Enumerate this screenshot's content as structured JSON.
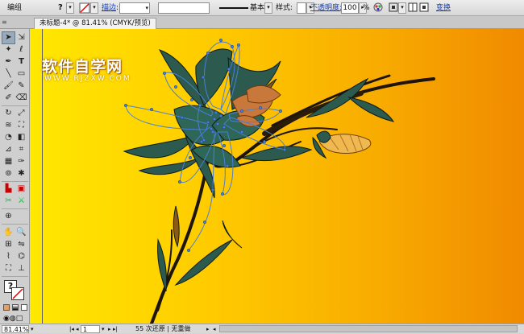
{
  "control_bar": {
    "mode_label": "编组",
    "stroke_label": "描边",
    "stroke_value": "",
    "brush_label": "基本",
    "style_label": "样式:",
    "opacity_label": "不透明度:",
    "opacity_value": "100",
    "percent": "%",
    "transform_label": "变换"
  },
  "document": {
    "tab_title": "未标题-4* @ 81.41% (CMYK/预览)"
  },
  "watermark": {
    "site_name": "软件自学网",
    "url": "WWW.RJZXW.COM"
  },
  "status_bar": {
    "zoom": "81.41%",
    "page": "1",
    "status_text": "55 次还原 | 无重做"
  },
  "colors": {
    "canvas_left": "#ffe800",
    "canvas_right": "#f08a00",
    "leaf_fill": "#2c5a4f",
    "stem": "#1e1408",
    "bud_fill": "#f0b850",
    "selection_path": "#4a7fd8"
  },
  "icons": {
    "selection_tool": "arrow-icon",
    "type_tool": "T-icon",
    "rectangle_tool": "rect-icon",
    "zoom_tool": "magnifier-icon"
  }
}
